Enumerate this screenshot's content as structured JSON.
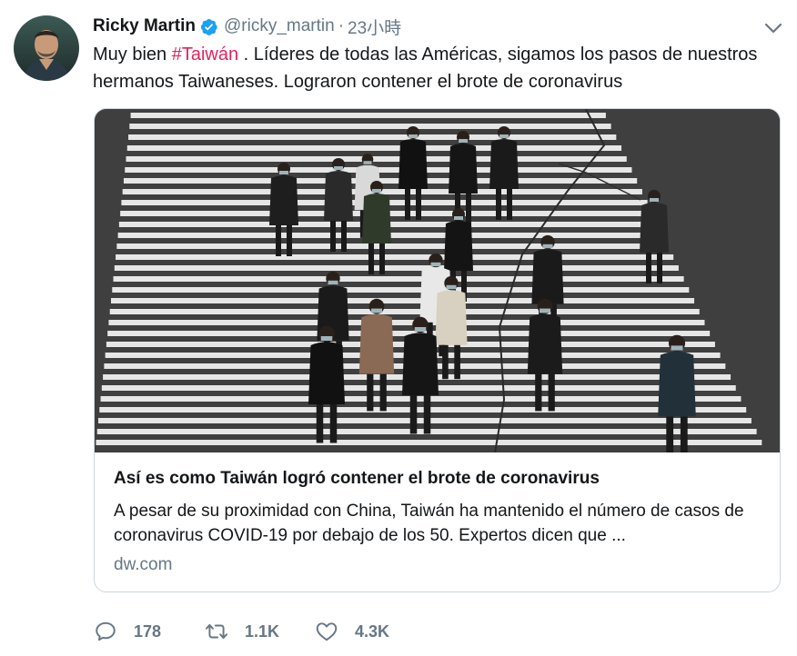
{
  "user": {
    "name": "Ricky Martin",
    "handle": "@ricky_martin",
    "separator": "·",
    "time": "23小時"
  },
  "tweet": {
    "text_before": "Muy bien ",
    "hashtag": "#Taiwán",
    "text_after": " . Líderes de todas las Américas, sigamos los pasos de nuestros hermanos Taiwaneses. Lograron contener el brote de coronavirus"
  },
  "card": {
    "title": "Así es como Taiwán logró contener el brote de coronavirus",
    "description": "A pesar de su proximidad con China, Taiwán ha mantenido el número de casos de coronavirus COVID-19 por debajo de los 50. Expertos dicen que ...",
    "domain": "dw.com"
  },
  "actions": {
    "replies": "178",
    "retweets": "1.1K",
    "likes": "4.3K"
  },
  "icons": {
    "verified": "verified-badge-icon",
    "caret": "chevron-down-icon",
    "reply": "comment-icon",
    "retweet": "retweet-icon",
    "like": "heart-icon"
  },
  "colors": {
    "verified": "#1da1f2",
    "hashtag": "#e0245e",
    "secondary_text": "#657786",
    "border": "#ccd6dd"
  }
}
